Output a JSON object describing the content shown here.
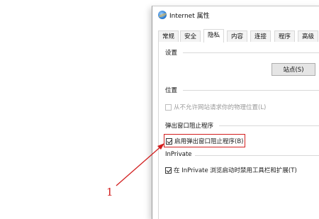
{
  "window": {
    "title": "Internet 属性",
    "icon": "internet-explorer-icon"
  },
  "tabs": [
    {
      "label": "常规",
      "active": false
    },
    {
      "label": "安全",
      "active": false
    },
    {
      "label": "隐私",
      "active": true
    },
    {
      "label": "内容",
      "active": false
    },
    {
      "label": "连接",
      "active": false
    },
    {
      "label": "程序",
      "active": false
    },
    {
      "label": "高级",
      "active": false
    }
  ],
  "settings_section": {
    "label": "设置",
    "sites_button_label": "站点(S)"
  },
  "location_section": {
    "label": "位置",
    "deny_location_label": "从不允许网站请求你的物理位置(L)",
    "deny_location_checked": false,
    "deny_location_enabled": false
  },
  "popup_section": {
    "label": "弹出窗口阻止程序",
    "enable_blocker_label": "启用弹出窗口阻止程序(B)",
    "enable_blocker_checked": true
  },
  "inprivate_section": {
    "label": "InPrivate",
    "disable_toolbars_label": "在 InPrivate 浏览启动时禁用工具栏和扩展(T)",
    "disable_toolbars_checked": true
  },
  "annotation": {
    "number": "1",
    "color": "#d21f1f"
  }
}
